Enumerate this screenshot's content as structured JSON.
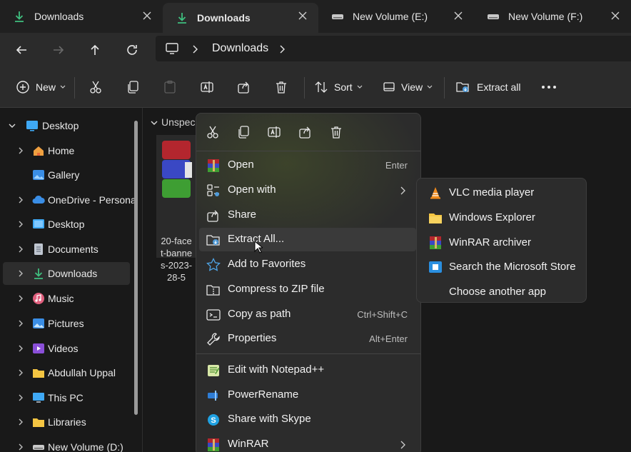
{
  "tabs": [
    {
      "label": "Downloads",
      "icon": "download-icon",
      "active": false
    },
    {
      "label": "Downloads",
      "icon": "download-icon",
      "active": true
    },
    {
      "label": "New Volume (E:)",
      "icon": "drive-icon",
      "active": false
    },
    {
      "label": "New Volume (F:)",
      "icon": "drive-icon",
      "active": false
    }
  ],
  "address": {
    "crumb": "Downloads"
  },
  "toolbar": {
    "new_label": "New",
    "sort_label": "Sort",
    "view_label": "View",
    "extract_label": "Extract all"
  },
  "sidebar": {
    "items": [
      {
        "label": "Desktop",
        "icon": "desktop-icon"
      },
      {
        "label": "Home",
        "icon": "home-icon"
      },
      {
        "label": "Gallery",
        "icon": "gallery-icon"
      },
      {
        "label": "OneDrive - Personal",
        "icon": "cloud-icon"
      },
      {
        "label": "Desktop",
        "icon": "desktop-icon"
      },
      {
        "label": "Documents",
        "icon": "documents-icon"
      },
      {
        "label": "Downloads",
        "icon": "download-icon"
      },
      {
        "label": "Music",
        "icon": "music-icon"
      },
      {
        "label": "Pictures",
        "icon": "pictures-icon"
      },
      {
        "label": "Videos",
        "icon": "videos-icon"
      },
      {
        "label": "Abdullah Uppal",
        "icon": "folder-icon"
      },
      {
        "label": "This PC",
        "icon": "pc-icon"
      },
      {
        "label": "Libraries",
        "icon": "folder-icon"
      },
      {
        "label": "New Volume (D:)",
        "icon": "drive-icon"
      }
    ]
  },
  "content": {
    "group_header": "Unspeci",
    "file_lines": [
      "20-face",
      "t-banne",
      "s-2023-",
      "28-5"
    ]
  },
  "context_menu": {
    "items": [
      {
        "label": "Open",
        "shortcut": "Enter",
        "icon": "winrar-icon"
      },
      {
        "label": "Open with",
        "shortcut": "",
        "icon": "open-with-icon",
        "submenu": true
      },
      {
        "label": "Share",
        "shortcut": "",
        "icon": "share-icon"
      },
      {
        "label": "Extract All...",
        "shortcut": "",
        "icon": "extract-icon"
      },
      {
        "label": "Add to Favorites",
        "shortcut": "",
        "icon": "star-icon"
      },
      {
        "label": "Compress to ZIP file",
        "shortcut": "",
        "icon": "zip-icon"
      },
      {
        "label": "Copy as path",
        "shortcut": "Ctrl+Shift+C",
        "icon": "copy-path-icon"
      },
      {
        "label": "Properties",
        "shortcut": "Alt+Enter",
        "icon": "wrench-icon"
      },
      {
        "label": "Edit with Notepad++",
        "shortcut": "",
        "icon": "notepadpp-icon"
      },
      {
        "label": "PowerRename",
        "shortcut": "",
        "icon": "powerrename-icon"
      },
      {
        "label": "Share with Skype",
        "shortcut": "",
        "icon": "skype-icon"
      },
      {
        "label": "WinRAR",
        "shortcut": "",
        "icon": "winrar-icon",
        "submenu": true
      }
    ]
  },
  "open_with_submenu": {
    "items": [
      {
        "label": "VLC media player",
        "icon": "vlc-icon"
      },
      {
        "label": "Windows Explorer",
        "icon": "folder-icon"
      },
      {
        "label": "WinRAR archiver",
        "icon": "winrar-icon"
      },
      {
        "label": "Search the Microsoft Store",
        "icon": "store-icon"
      },
      {
        "label": "Choose another app",
        "icon": ""
      }
    ]
  },
  "colors": {
    "accent_green": "#3fbf7f",
    "menu_bg": "#2c2c2c",
    "window_bg": "#191919"
  }
}
